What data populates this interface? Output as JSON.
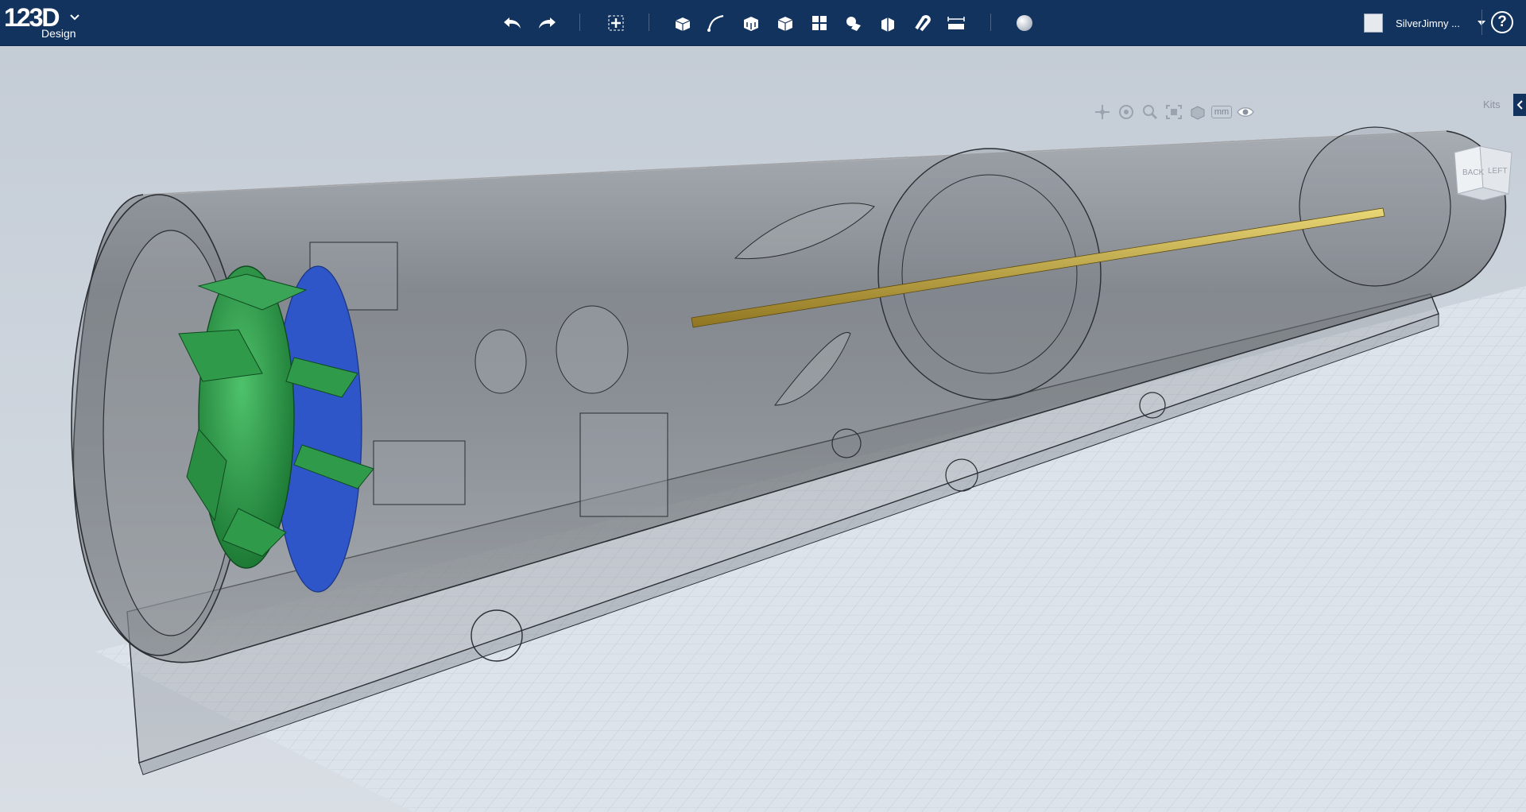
{
  "app": {
    "logo_number": "123D",
    "logo_word": "Design"
  },
  "toolbar": {
    "undo": "undo-icon",
    "redo": "redo-icon",
    "tools": [
      "transform-icon",
      "primitives-icon",
      "sketch-icon",
      "construct-icon",
      "modify-icon",
      "pattern-icon",
      "grouping-icon",
      "combine-icon",
      "snap-icon",
      "measure-icon",
      "material-icon"
    ]
  },
  "user": {
    "name": "SilverJimny ..."
  },
  "help_label": "?",
  "viewport": {
    "units_label": "mm",
    "kits_label": "Kits",
    "viewcube": {
      "face_back": "BACK",
      "face_left": "LEFT"
    },
    "colors": {
      "green_part": "#2f9b4a",
      "blue_part": "#2f56c9",
      "rod": "#c7ab3a",
      "topbar": "#13335f"
    }
  }
}
